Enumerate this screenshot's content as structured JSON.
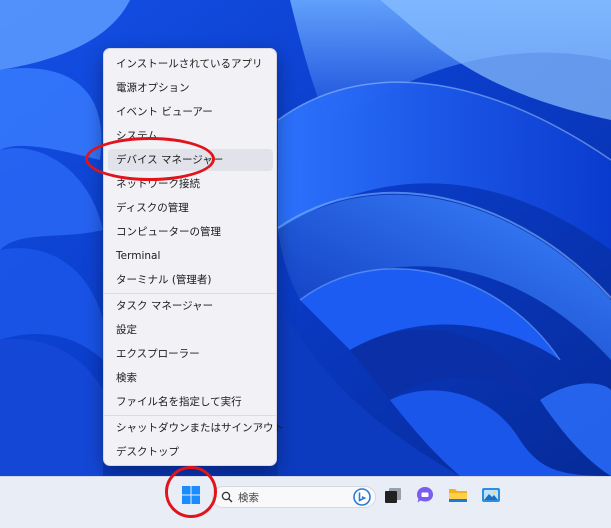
{
  "context_menu": {
    "items": [
      {
        "label": "インストールされているアプリ"
      },
      {
        "label": "電源オプション"
      },
      {
        "label": "イベント ビューアー"
      },
      {
        "label": "システム"
      },
      {
        "label": "デバイス マネージャー"
      },
      {
        "label": "ネットワーク接続"
      },
      {
        "label": "ディスクの管理"
      },
      {
        "label": "コンピューターの管理"
      },
      {
        "label": "Terminal"
      },
      {
        "label": "ターミナル (管理者)"
      },
      {
        "label": "タスク マネージャー"
      },
      {
        "label": "設定"
      },
      {
        "label": "エクスプローラー"
      },
      {
        "label": "検索"
      },
      {
        "label": "ファイル名を指定して実行"
      },
      {
        "label": "シャットダウンまたはサインアウト"
      },
      {
        "label": "デスクトップ"
      }
    ],
    "highlighted_item": "デバイス マネージャー",
    "submenu_chevron": "›"
  },
  "taskbar": {
    "search_placeholder": "検索",
    "icons": [
      "windows-start-icon",
      "search-icon",
      "bing-icon",
      "task-view-icon",
      "chat-icon",
      "file-explorer-icon",
      "photos-icon"
    ]
  },
  "annotation_color": "#e0141a",
  "wallpaper_colors": [
    "#0a3fd0",
    "#1f63ff",
    "#5ea0ff"
  ]
}
